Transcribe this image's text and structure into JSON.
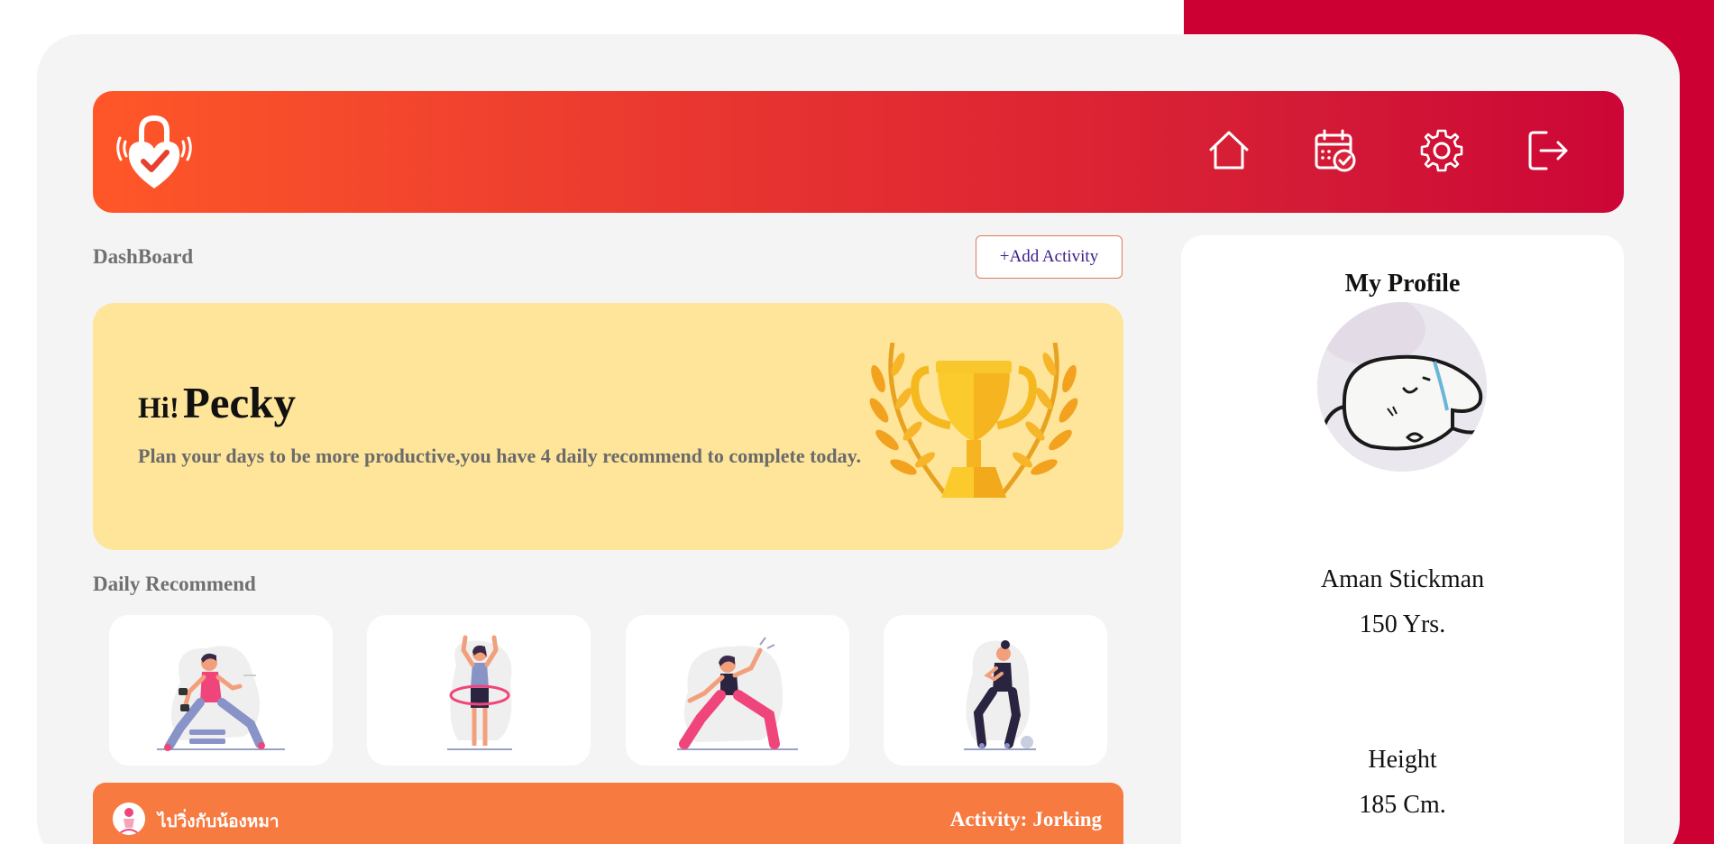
{
  "header": {
    "logo_icon": "heart-lock-check-icon",
    "nav": [
      {
        "name": "home",
        "icon": "home-icon"
      },
      {
        "name": "calendar",
        "icon": "calendar-check-icon"
      },
      {
        "name": "settings",
        "icon": "gear-icon"
      },
      {
        "name": "logout",
        "icon": "logout-icon"
      }
    ]
  },
  "dashboard": {
    "title": "DashBoard",
    "add_activity_label": "+Add Activity"
  },
  "welcome": {
    "hi": "Hi!",
    "name": "Pecky",
    "message": "Plan your days to be more productive,you have 4 daily recommend to complete today.",
    "illustration": "trophy-icon"
  },
  "daily": {
    "title": "Daily Recommend",
    "items": [
      {
        "illustration": "dumbbell-lunge-illustration"
      },
      {
        "illustration": "hula-hoop-illustration"
      },
      {
        "illustration": "stretch-lunge-illustration"
      },
      {
        "illustration": "squat-ball-illustration"
      }
    ]
  },
  "activity": {
    "name": "ไปวิ่งกับน้องหมา",
    "label": "Activity:",
    "type": "Jorking"
  },
  "profile": {
    "title": "My Profile",
    "full_name": "Aman Stickman",
    "age": "150 Yrs.",
    "height_label": "Height",
    "height_value": "185 Cm."
  },
  "colors": {
    "brand_red": "#cc0033",
    "header_gradient_start": "#ff5728",
    "header_gradient_end": "#cc0636",
    "welcome_bg": "#fee59a",
    "activity_bg": "#f77a40",
    "add_button_border": "#e0795a"
  }
}
